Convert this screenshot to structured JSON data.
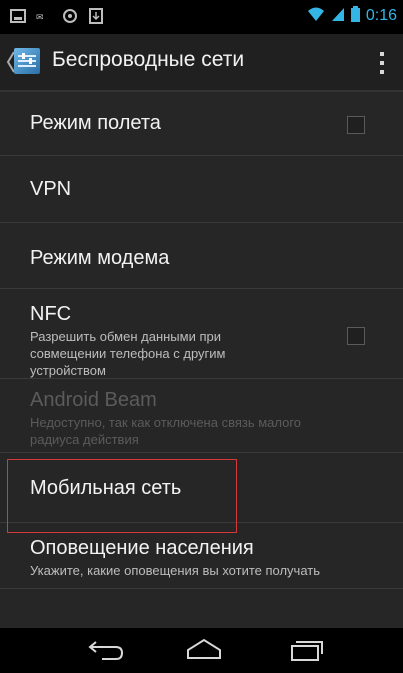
{
  "status_bar": {
    "time": "0:16",
    "left_icons": [
      "screenshot-icon",
      "email-icon",
      "settings-icon",
      "download-icon"
    ],
    "right_icons": [
      "wifi-icon",
      "signal-icon",
      "battery-icon"
    ]
  },
  "action_bar": {
    "title": "Беспроводные сети"
  },
  "items": [
    {
      "title": "Режим полета",
      "checkbox": true,
      "checked": false
    },
    {
      "title": "VPN"
    },
    {
      "title": "Режим модема"
    },
    {
      "title": "NFC",
      "subtitle_lines": [
        "Разрешить обмен данными при",
        "совмещении телефона с другим",
        "устройством"
      ],
      "checkbox": true,
      "checked": false
    },
    {
      "title": "Android Beam",
      "subtitle_lines": [
        "Недоступно, так как отключена связь малого",
        "радиуса действия"
      ],
      "disabled": true
    },
    {
      "title": "Мобильная сеть"
    },
    {
      "title": "Оповещение населения",
      "subtitle_lines": [
        "Укажите, какие оповещения вы хотите получать"
      ]
    }
  ],
  "nav_bar": {
    "buttons": [
      "back-icon",
      "home-icon",
      "recent-apps-icon"
    ]
  },
  "colors": {
    "accent": "#33b5e5",
    "background": "#262626",
    "highlight": "#d43a3a"
  }
}
